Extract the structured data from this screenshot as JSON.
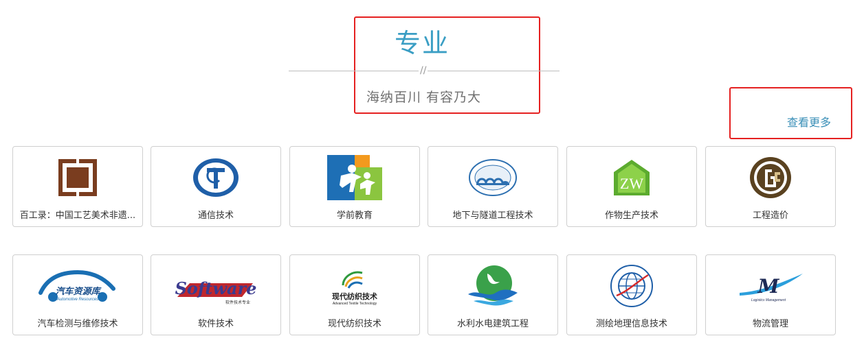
{
  "header": {
    "title": "专业",
    "divider_mark": "//",
    "subtitle": "海纳百川 有容乃大"
  },
  "more_link": "查看更多",
  "colors": {
    "accent": "#3a9ec4",
    "highlight_border": "#e52020"
  },
  "majors": [
    {
      "label": "百工录：中国工艺美术非遗...",
      "icon": "fret-pattern-icon"
    },
    {
      "label": "通信技术",
      "icon": "communication-tech-logo-icon"
    },
    {
      "label": "学前教育",
      "icon": "preschool-children-icon"
    },
    {
      "label": "地下与隧道工程技术",
      "icon": "tunnel-logo-icon"
    },
    {
      "label": "作物生产技术",
      "icon": "crop-house-icon"
    },
    {
      "label": "工程造价",
      "icon": "engineering-cost-logo-icon"
    },
    {
      "label": "汽车检测与维修技术",
      "icon": "car-logo-icon",
      "logo_text": "汽车资源库",
      "logo_subtext": "Automotive Resources"
    },
    {
      "label": "软件技术",
      "icon": "software-logo-icon",
      "logo_text": "Software",
      "logo_subtext": "软件技术专业"
    },
    {
      "label": "现代纺织技术",
      "icon": "textile-logo-icon",
      "logo_text": "现代纺织技术",
      "logo_subtext": "Advanced Textile Technology"
    },
    {
      "label": "水利水电建筑工程",
      "icon": "water-wave-logo-icon"
    },
    {
      "label": "测绘地理信息技术",
      "icon": "globe-logo-icon"
    },
    {
      "label": "物流管理",
      "icon": "logistics-logo-icon",
      "logo_text": "M",
      "logo_subtext": "Logistics Management"
    }
  ]
}
